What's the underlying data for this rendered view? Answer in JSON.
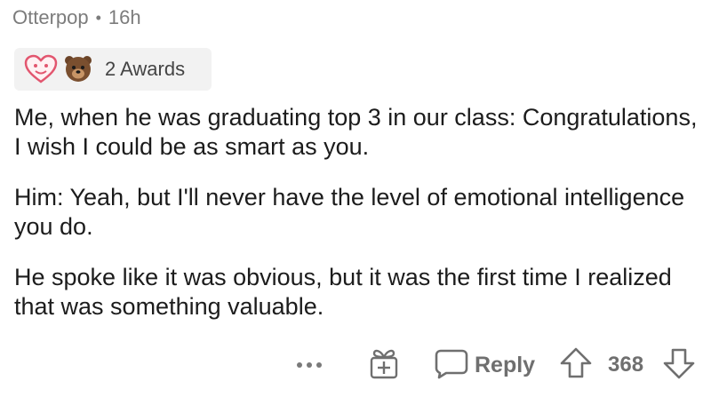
{
  "comment": {
    "author": "Otterpop",
    "separator": "•",
    "age": "16h",
    "awards_label": "2 Awards",
    "award_icons": [
      "heart-award-icon",
      "bear-award-icon"
    ],
    "paragraphs": [
      "Me, when he was graduating top 3 in our class: Congratulations, I wish I could be as smart as you.",
      "Him: Yeah, but I'll never have the level of emotional intelligence you do.",
      "He spoke like it was obvious, but it was the first time I realized that was something valuable."
    ]
  },
  "actions": {
    "more_icon": "more-options-icon",
    "gift_icon": "gift-icon",
    "reply_label": "Reply",
    "score": "368"
  },
  "colors": {
    "meta": "#7c7c7c",
    "text": "#1c1c1c",
    "actions": "#6f6f6f",
    "award_bg": "#f2f2f2"
  }
}
